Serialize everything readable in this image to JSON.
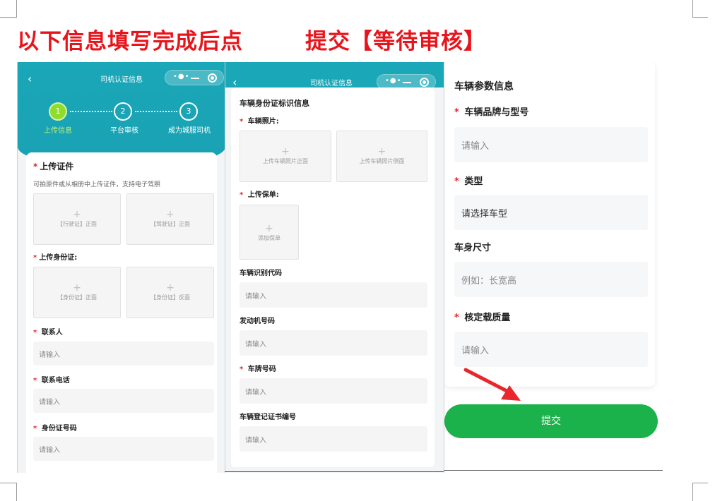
{
  "heading": {
    "part1": "以下信息填写完成后点",
    "part2": "提交【等待审核】"
  },
  "colors": {
    "teal": "#1aa7b8",
    "green": "#1cb24b",
    "red": "#e8141b",
    "step_active": "#8fdc2c"
  },
  "panel1": {
    "nav_title": "司机认证信息",
    "back_icon": "chevron-left-icon",
    "steps": [
      {
        "num": "1",
        "label": "上传信息"
      },
      {
        "num": "2",
        "label": "平台审核"
      },
      {
        "num": "3",
        "label": "成为城服司机"
      }
    ],
    "upload_cert": {
      "title": "上传证件",
      "note": "可拍原件或从相册中上传证件，支持电子驾照",
      "boxes": [
        "【行驶证】正面",
        "【驾驶证】正面"
      ]
    },
    "upload_id": {
      "title": "上传身份证:",
      "boxes": [
        "【身份证】正面",
        "【身份证】反面"
      ]
    },
    "fields": [
      {
        "label": "联系人",
        "placeholder": "请输入"
      },
      {
        "label": "联系电话",
        "placeholder": "请输入"
      },
      {
        "label": "身份证号码",
        "placeholder": "请输入"
      }
    ]
  },
  "panel2": {
    "nav_title": "司机认证信息",
    "section_title": "车辆身份证标识信息",
    "photos_label": "车辆照片:",
    "photo_boxes": [
      "上传车辆照片正面",
      "上传车辆照片侧面"
    ],
    "policy_label": "上传保单:",
    "policy_box": "添加保单",
    "fields": [
      {
        "label": "车辆识别代码",
        "placeholder": "请输入"
      },
      {
        "label": "发动机号码",
        "placeholder": "请输入"
      },
      {
        "label": "车牌号码",
        "placeholder": "请输入"
      },
      {
        "label": "车辆登记证书编号",
        "placeholder": "请输入"
      }
    ]
  },
  "panel3": {
    "section_title": "车辆参数信息",
    "fields": [
      {
        "label": "车辆品牌与型号",
        "placeholder": "请输入"
      },
      {
        "label": "类型",
        "placeholder": "请选择车型"
      },
      {
        "label": "车身尺寸",
        "placeholder": "例如：长宽高"
      },
      {
        "label": "核定载质量",
        "placeholder": "请输入"
      }
    ],
    "submit_label": "提交"
  }
}
